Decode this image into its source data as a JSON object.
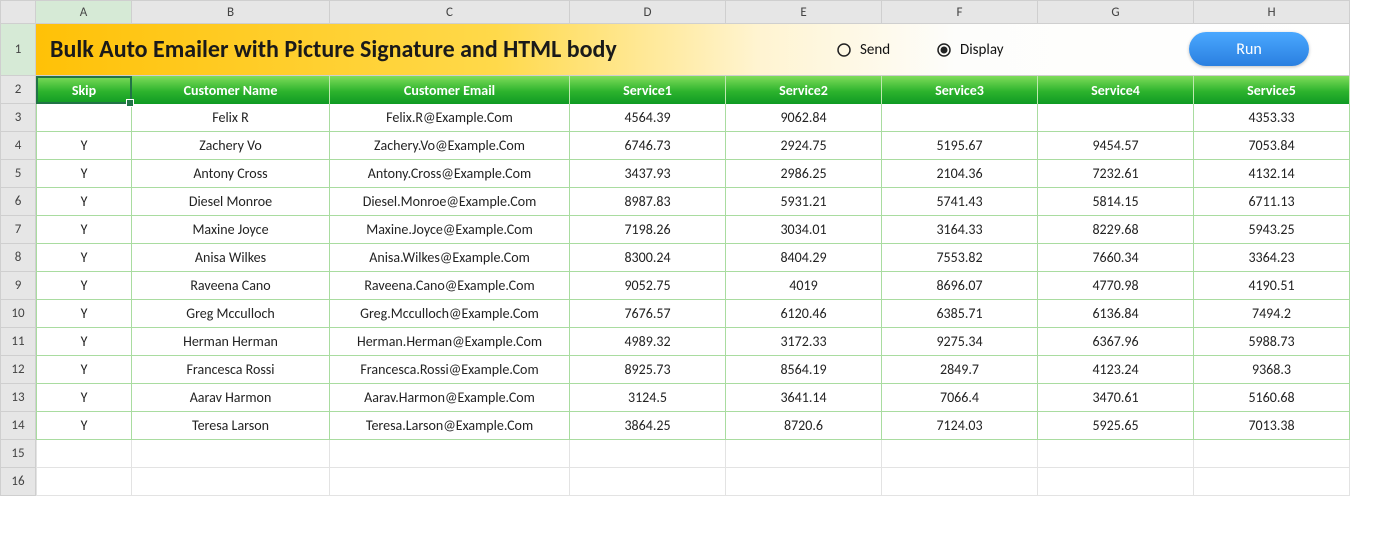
{
  "columns": [
    "A",
    "B",
    "C",
    "D",
    "E",
    "F",
    "G",
    "H"
  ],
  "row_numbers": [
    1,
    2,
    3,
    4,
    5,
    6,
    7,
    8,
    9,
    10,
    11,
    12,
    13,
    14,
    15,
    16
  ],
  "title": "Bulk Auto Emailer with Picture Signature and HTML body",
  "controls": {
    "radio_send": "Send",
    "radio_display": "Display",
    "run_button": "Run"
  },
  "headers": [
    "Skip",
    "Customer Name",
    "Customer Email",
    "Service1",
    "Service2",
    "Service3",
    "Service4",
    "Service5"
  ],
  "rows": [
    {
      "skip": "",
      "name": "Felix R",
      "email": "Felix.R@Example.Com",
      "s1": "4564.39",
      "s2": "9062.84",
      "s3": "",
      "s4": "",
      "s5": "4353.33"
    },
    {
      "skip": "Y",
      "name": "Zachery Vo",
      "email": "Zachery.Vo@Example.Com",
      "s1": "6746.73",
      "s2": "2924.75",
      "s3": "5195.67",
      "s4": "9454.57",
      "s5": "7053.84"
    },
    {
      "skip": "Y",
      "name": "Antony Cross",
      "email": "Antony.Cross@Example.Com",
      "s1": "3437.93",
      "s2": "2986.25",
      "s3": "2104.36",
      "s4": "7232.61",
      "s5": "4132.14"
    },
    {
      "skip": "Y",
      "name": "Diesel Monroe",
      "email": "Diesel.Monroe@Example.Com",
      "s1": "8987.83",
      "s2": "5931.21",
      "s3": "5741.43",
      "s4": "5814.15",
      "s5": "6711.13"
    },
    {
      "skip": "Y",
      "name": "Maxine Joyce",
      "email": "Maxine.Joyce@Example.Com",
      "s1": "7198.26",
      "s2": "3034.01",
      "s3": "3164.33",
      "s4": "8229.68",
      "s5": "5943.25"
    },
    {
      "skip": "Y",
      "name": "Anisa Wilkes",
      "email": "Anisa.Wilkes@Example.Com",
      "s1": "8300.24",
      "s2": "8404.29",
      "s3": "7553.82",
      "s4": "7660.34",
      "s5": "3364.23"
    },
    {
      "skip": "Y",
      "name": "Raveena Cano",
      "email": "Raveena.Cano@Example.Com",
      "s1": "9052.75",
      "s2": "4019",
      "s3": "8696.07",
      "s4": "4770.98",
      "s5": "4190.51"
    },
    {
      "skip": "Y",
      "name": "Greg Mcculloch",
      "email": "Greg.Mcculloch@Example.Com",
      "s1": "7676.57",
      "s2": "6120.46",
      "s3": "6385.71",
      "s4": "6136.84",
      "s5": "7494.2"
    },
    {
      "skip": "Y",
      "name": "Herman Herman",
      "email": "Herman.Herman@Example.Com",
      "s1": "4989.32",
      "s2": "3172.33",
      "s3": "9275.34",
      "s4": "6367.96",
      "s5": "5988.73"
    },
    {
      "skip": "Y",
      "name": "Francesca Rossi",
      "email": "Francesca.Rossi@Example.Com",
      "s1": "8925.73",
      "s2": "8564.19",
      "s3": "2849.7",
      "s4": "4123.24",
      "s5": "9368.3"
    },
    {
      "skip": "Y",
      "name": "Aarav Harmon",
      "email": "Aarav.Harmon@Example.Com",
      "s1": "3124.5",
      "s2": "3641.14",
      "s3": "7066.4",
      "s4": "3470.61",
      "s5": "5160.68"
    },
    {
      "skip": "Y",
      "name": "Teresa Larson",
      "email": "Teresa.Larson@Example.Com",
      "s1": "3864.25",
      "s2": "8720.6",
      "s3": "7124.03",
      "s4": "5925.65",
      "s5": "7013.38"
    }
  ],
  "chart_data": {
    "type": "table",
    "title": "Bulk Auto Emailer with Picture Signature and HTML body",
    "columns": [
      "Skip",
      "Customer Name",
      "Customer Email",
      "Service1",
      "Service2",
      "Service3",
      "Service4",
      "Service5"
    ],
    "rows": [
      [
        "",
        "Felix R",
        "Felix.R@Example.Com",
        4564.39,
        9062.84,
        null,
        null,
        4353.33
      ],
      [
        "Y",
        "Zachery Vo",
        "Zachery.Vo@Example.Com",
        6746.73,
        2924.75,
        5195.67,
        9454.57,
        7053.84
      ],
      [
        "Y",
        "Antony Cross",
        "Antony.Cross@Example.Com",
        3437.93,
        2986.25,
        2104.36,
        7232.61,
        4132.14
      ],
      [
        "Y",
        "Diesel Monroe",
        "Diesel.Monroe@Example.Com",
        8987.83,
        5931.21,
        5741.43,
        5814.15,
        6711.13
      ],
      [
        "Y",
        "Maxine Joyce",
        "Maxine.Joyce@Example.Com",
        7198.26,
        3034.01,
        3164.33,
        8229.68,
        5943.25
      ],
      [
        "Y",
        "Anisa Wilkes",
        "Anisa.Wilkes@Example.Com",
        8300.24,
        8404.29,
        7553.82,
        7660.34,
        3364.23
      ],
      [
        "Y",
        "Raveena Cano",
        "Raveena.Cano@Example.Com",
        9052.75,
        4019,
        8696.07,
        4770.98,
        4190.51
      ],
      [
        "Y",
        "Greg Mcculloch",
        "Greg.Mcculloch@Example.Com",
        7676.57,
        6120.46,
        6385.71,
        6136.84,
        7494.2
      ],
      [
        "Y",
        "Herman Herman",
        "Herman.Herman@Example.Com",
        4989.32,
        3172.33,
        9275.34,
        6367.96,
        5988.73
      ],
      [
        "Y",
        "Francesca Rossi",
        "Francesca.Rossi@Example.Com",
        8925.73,
        8564.19,
        2849.7,
        4123.24,
        9368.3
      ],
      [
        "Y",
        "Aarav Harmon",
        "Aarav.Harmon@Example.Com",
        3124.5,
        3641.14,
        7066.4,
        3470.61,
        5160.68
      ],
      [
        "Y",
        "Teresa Larson",
        "Teresa.Larson@Example.Com",
        3864.25,
        8720.6,
        7124.03,
        5925.65,
        7013.38
      ]
    ]
  }
}
